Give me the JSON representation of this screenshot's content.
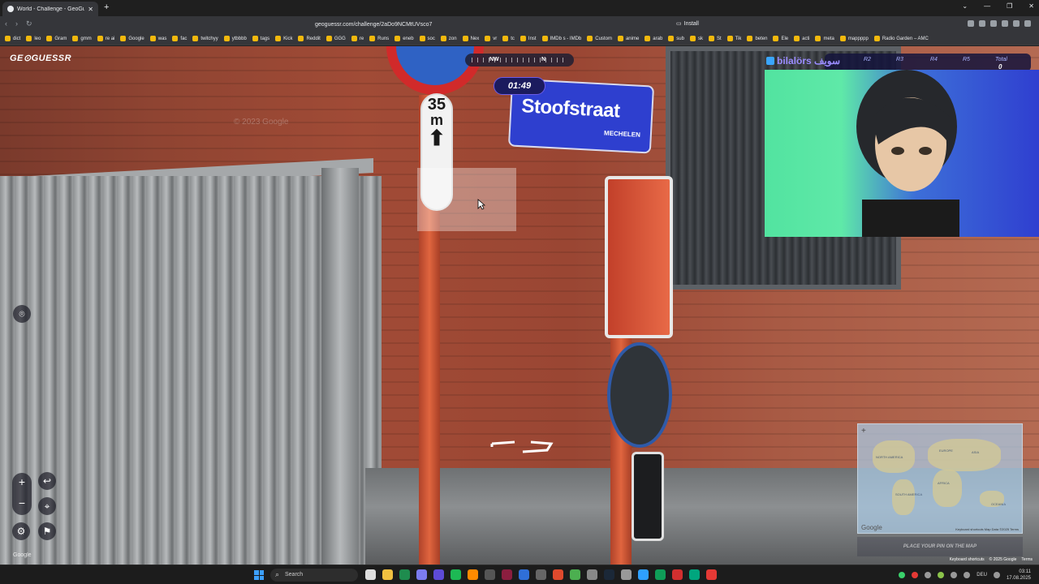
{
  "browser": {
    "tab_title": "World - Challenge - GeoGuessr",
    "url": "geoguessr.com/challenge/2aDo9NCMtUVsco7",
    "install_label": "Install",
    "bookmarks": [
      "dict",
      "leo",
      "Gram",
      "gmm",
      "re ai",
      "Google",
      "was",
      "fac",
      "twitchyy",
      "ytbbbb",
      "tags",
      "Kick",
      "Reddit",
      "GGG",
      "re",
      "Runs",
      "eneb",
      "soc",
      "zon",
      "Nex",
      "vr",
      "tc",
      "Inst",
      "IMDb s - IMDb",
      "Custom",
      "anime",
      "arab",
      "sub",
      "sk",
      "St",
      "Tik",
      "beten",
      "Ele",
      "acti",
      "meta",
      "mappppp",
      "Radio Garden – AMC"
    ]
  },
  "game": {
    "logo": "GE⊙GUESSR",
    "compass_nw": "NW",
    "compass_n": "N",
    "timer": "01:49",
    "place_pin": "PLACE YOUR PIN ON THE MAP",
    "google_label": "Google",
    "keyboard_shortcuts": "Keyboard shortcuts",
    "copyright": "© 2025 Google",
    "terms": "Terms",
    "rounds": [
      "R2",
      "R3",
      "R4",
      "R5",
      "Total"
    ],
    "total_value": "0"
  },
  "scene": {
    "street_name": "Stoofstraat",
    "street_city": "MECHELEN",
    "speed_number": "35",
    "speed_unit": "m",
    "watermark": "© 2023 Google"
  },
  "minimap": {
    "google": "Google",
    "footer": "Keyboard shortcuts   Map Data ©2025   Terms",
    "labels": [
      "NORTH AMERICA",
      "SOUTH AMERICA",
      "AFRICA",
      "EUROPE",
      "ASIA",
      "OCEANIA"
    ]
  },
  "stream": {
    "streamer_name": "bilalörs سويف"
  },
  "taskbar": {
    "search": "Search",
    "lang": "DEU",
    "time": "03:11",
    "date": "17.08.2025"
  },
  "colors": {
    "accent": "#6c5ce7",
    "timer_bg": "#1b1b5e",
    "street_sign": "#2e3fcf",
    "pole": "#e0653f"
  }
}
